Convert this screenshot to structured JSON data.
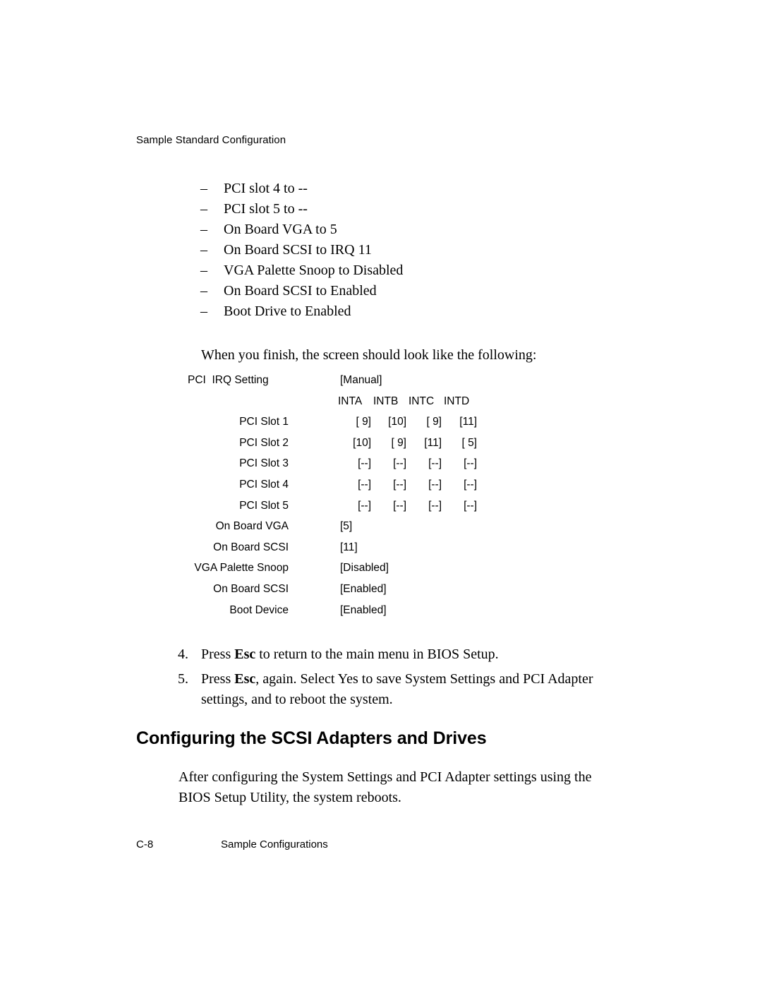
{
  "running_header": "Sample Standard Configuration",
  "settings_list": {
    "marker": "–",
    "items": [
      "PCI slot 4 to --",
      "PCI slot 5 to --",
      "On Board VGA to 5",
      "On Board SCSI to IRQ 11",
      "VGA Palette Snoop to Disabled",
      "On Board SCSI to Enabled",
      "Boot Drive to Enabled"
    ]
  },
  "intro_line": "When you finish, the screen should look like the following:",
  "bios_screen": {
    "lead_row": {
      "label": "PCI  IRQ Setting",
      "value": "[Manual]"
    },
    "column_headers": [
      "INTA",
      "INTB",
      "INTC",
      "INTD"
    ],
    "grid_rows": [
      {
        "label": "PCI Slot 1",
        "values": [
          "[ 9]",
          "[10]",
          "[ 9]",
          "[11]"
        ]
      },
      {
        "label": "PCI Slot 2",
        "values": [
          "[10]",
          "[ 9]",
          "[11]",
          "[ 5]"
        ]
      },
      {
        "label": "PCI Slot 3",
        "values": [
          "[--]",
          "[--]",
          "[--]",
          "[--]"
        ]
      },
      {
        "label": "PCI Slot 4",
        "values": [
          "[--]",
          "[--]",
          "[--]",
          "[--]"
        ]
      },
      {
        "label": "PCI Slot 5",
        "values": [
          "[--]",
          "[--]",
          "[--]",
          "[--]"
        ]
      }
    ],
    "single_rows": [
      {
        "label": "On Board VGA",
        "value": "[5]"
      },
      {
        "label": "On Board SCSI",
        "value": "[11]"
      },
      {
        "label": "VGA Palette Snoop",
        "value": "[Disabled]"
      },
      {
        "label": "On Board SCSI",
        "value": "[Enabled]"
      },
      {
        "label": "Boot Device",
        "value": "[Enabled]"
      }
    ]
  },
  "steps": [
    {
      "number": "4.",
      "prefix": "Press ",
      "bold": "Esc",
      "suffix": " to return to the main menu in BIOS Setup."
    },
    {
      "number": "5.",
      "prefix": "Press ",
      "bold": "Esc",
      "suffix": ", again. Select Yes to save System Settings and PCI Adapter settings, and to reboot the system."
    }
  ],
  "section_heading": "Configuring the SCSI Adapters and Drives",
  "body_paragraph": {
    "line1": "After configuring the System Settings and PCI Adapter settings using the",
    "line2": "BIOS Setup Utility, the system reboots."
  },
  "footer": {
    "page_number": "C-8",
    "title": "Sample Configurations"
  }
}
